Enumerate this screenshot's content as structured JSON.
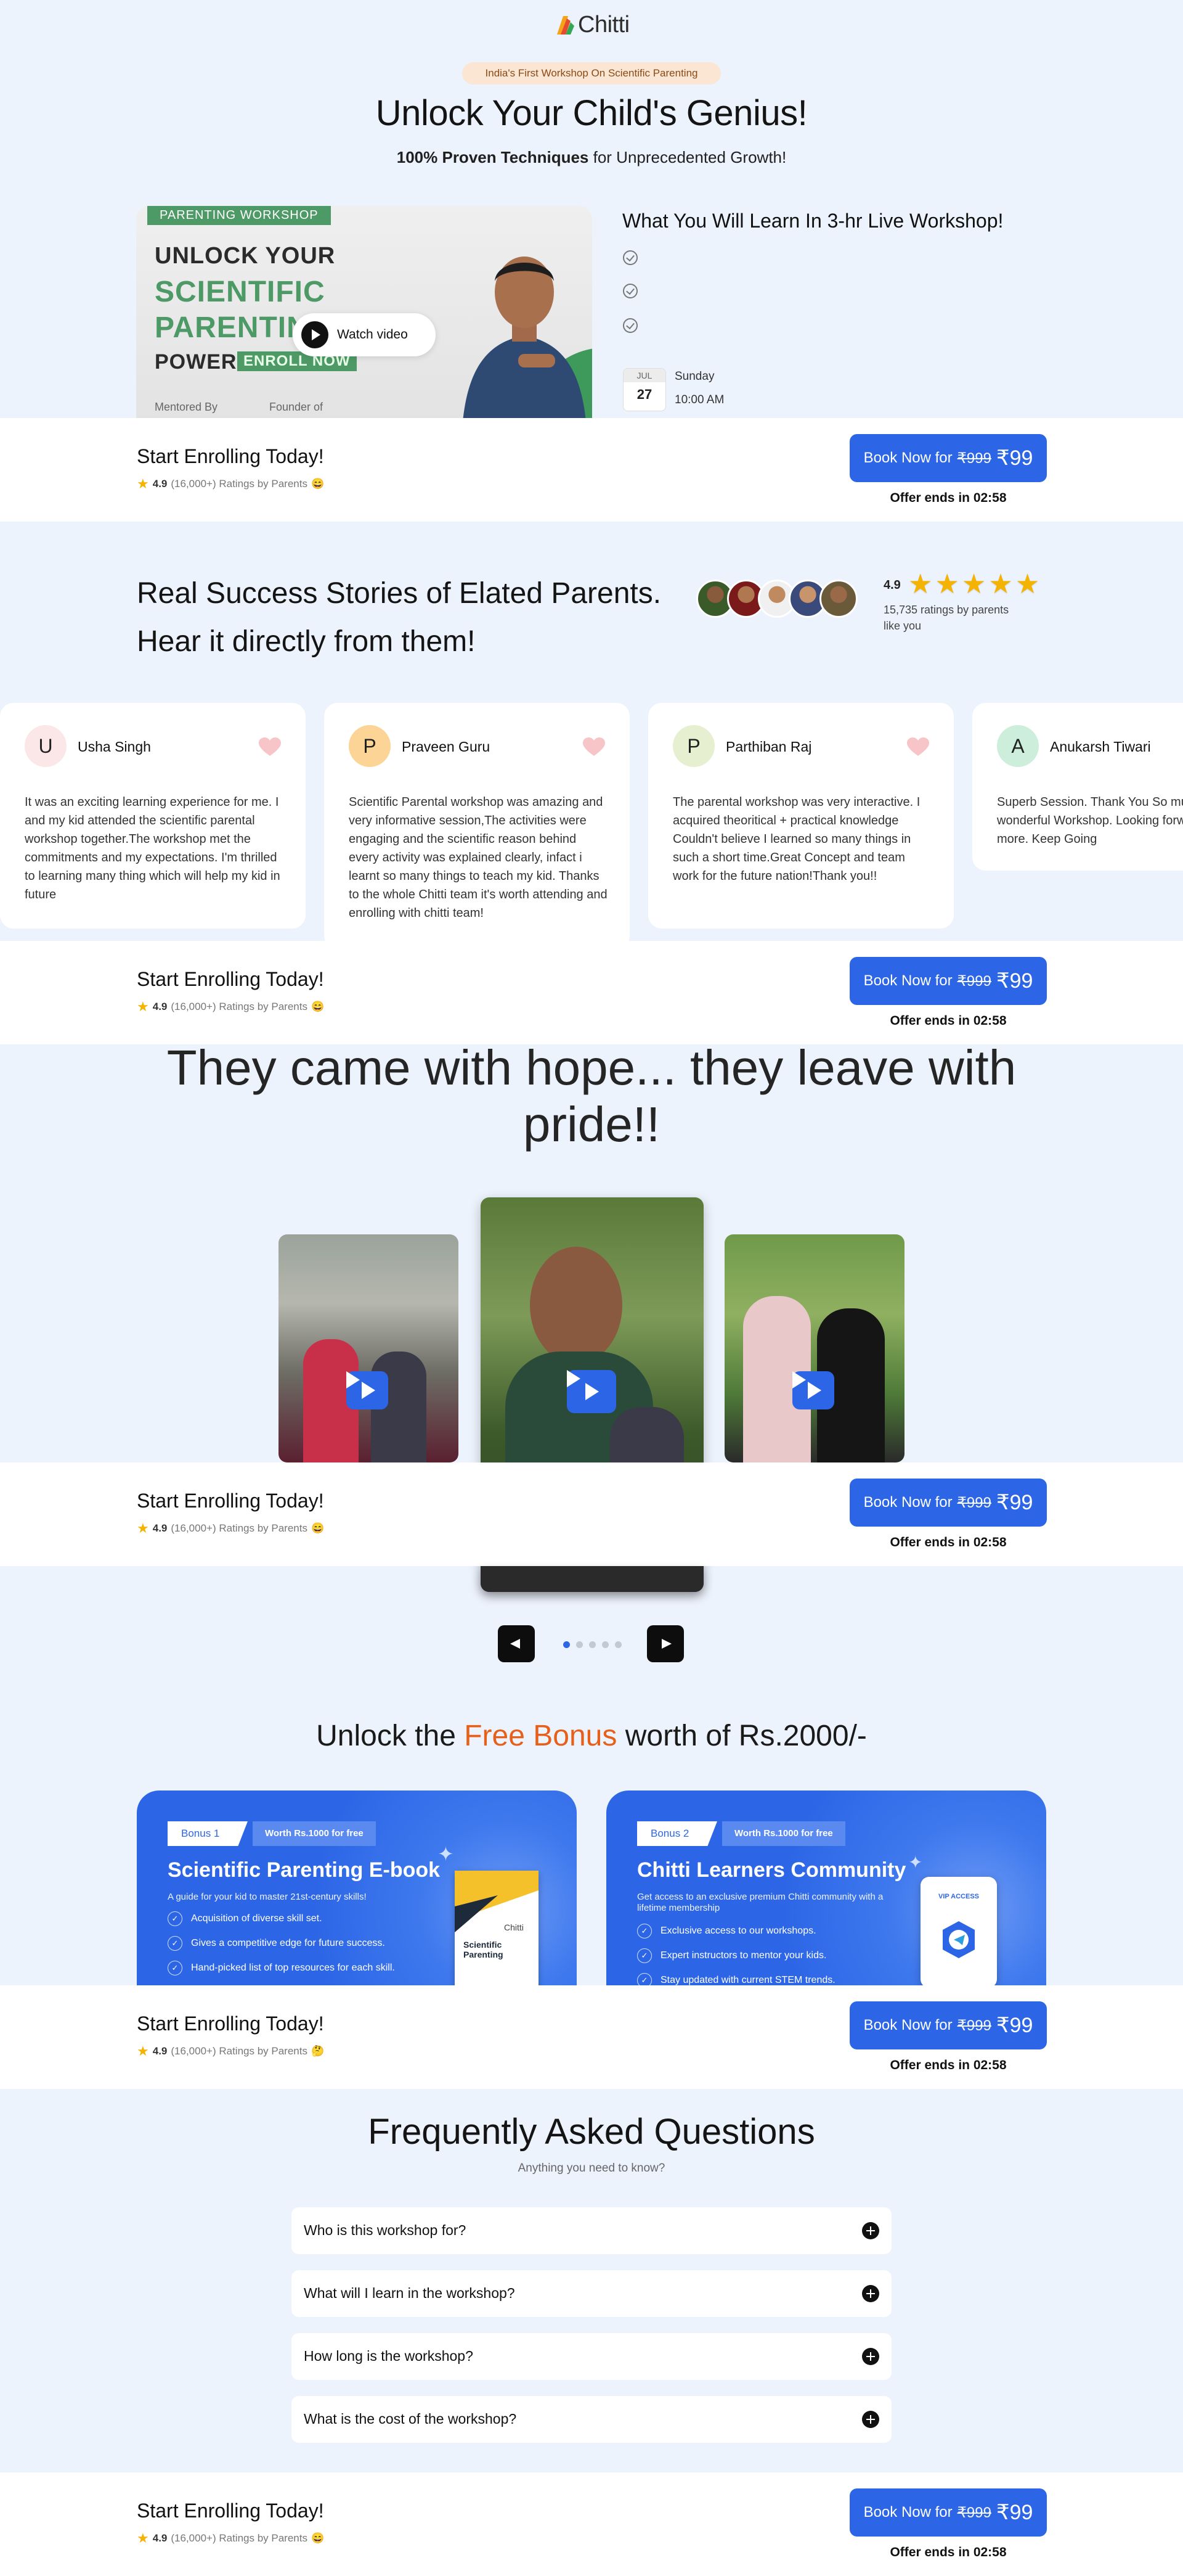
{
  "brand": {
    "name": "Chitti"
  },
  "hero": {
    "pill": "India's First Workshop On Scientific Parenting",
    "title": "Unlock Your Child's Genius!",
    "subtitle_bold": "100% Proven Techniques",
    "subtitle_rest": " for Unprecedented Growth!",
    "video": {
      "badge": "PARENTING WORKSHOP",
      "line1": "UNLOCK YOUR",
      "line2": "SCIENTIFIC",
      "line3": "PARENTIN",
      "line4": "POWER",
      "enroll": "ENROLL NOW",
      "mentor": "Mentored By",
      "founder": "Founder of",
      "watch_label": "Watch video"
    },
    "learn_title": "What You Will Learn In 3-hr Live Workshop!",
    "date": {
      "month": "JUL",
      "day": "27",
      "weekday": "Sunday",
      "time": "10:00 AM"
    }
  },
  "cta": {
    "title": "Start Enrolling Today!",
    "rating": "4.9",
    "rating_text": "(16,000+) Ratings by Parents",
    "emoji_happy": "😄",
    "emoji_alt": "🤔",
    "btn_prefix": "Book Now for",
    "old_price": "₹999",
    "new_price": "₹99",
    "offer": "Offer ends in 02:58"
  },
  "stories": {
    "title_line1": "Real Success Stories of Elated Parents.",
    "title_line2": "Hear it directly from them!",
    "rating": "4.9",
    "rating_sub": "15,735 ratings by parents like you",
    "reviews": [
      {
        "initial": "U",
        "name": "Usha Singh",
        "color": "#fbe7e7",
        "text": "It was an exciting learning experience for me. I and my kid attended the scientific parental workshop together.The workshop met the commitments and my expectations. I'm thrilled to learning many thing which will help my kid in future"
      },
      {
        "initial": "P",
        "name": "Praveen Guru",
        "color": "#fcd596",
        "text": "Scientific Parental workshop was amazing and very informative session,The activities were engaging and the scientific reason behind every activity was explained clearly, infact i learnt so many things to teach my kid. Thanks to the whole Chitti team it's worth attending and enrolling with chitti team!"
      },
      {
        "initial": "P",
        "name": "Parthiban Raj",
        "color": "#e6efcf",
        "text": "The parental workshop was very interactive. I acquired theoritical + practical knowledge Couldn't believe I learned so many things in such a short time.Great Concept and team work for the future nation!Thank you!!"
      },
      {
        "initial": "A",
        "name": "Anukarsh Tiwari",
        "color": "#cdeedb",
        "text": "Superb Session. Thank You So much for this wonderful Workshop. Looking forward for more. Keep Going"
      }
    ]
  },
  "hope": {
    "title": "They came with hope... they leave with pride!!"
  },
  "bonus": {
    "title_pre": "Unlock the ",
    "title_free": "Free Bonus",
    "title_post": " worth of Rs.2000/-",
    "cards": [
      {
        "tag": "Bonus 1",
        "worth": "Worth Rs.1000 for free",
        "head": "Scientific Parenting E-book",
        "desc": "A guide for your kid to master 21st-century skills!",
        "items": [
          "Acquisition of diverse skill set.",
          "Gives a competitive edge for future success.",
          "Hand-picked list of top resources for each skill."
        ],
        "book_title": "Scientific Parenting"
      },
      {
        "tag": "Bonus 2",
        "worth": "Worth Rs.1000 for free",
        "head": "Chitti Learners Community",
        "desc": "Get access to an exclusive premium Chitti community with a lifetime membership",
        "items": [
          "Exclusive access to our workshops.",
          "Expert instructors to mentor your kids.",
          "Stay updated with current STEM trends."
        ],
        "vip": "VIP ACCESS"
      }
    ]
  },
  "faq": {
    "title": "Frequently Asked Questions",
    "subtitle": "Anything you need to know?",
    "items": [
      "Who is this workshop for?",
      "What will I learn in the workshop?",
      "How long is the workshop?",
      "What is the cost of the workshop?"
    ]
  },
  "colors": {
    "accent": "#2c66e6",
    "orange": "#e6601c",
    "page_bg": "#edf3fd"
  }
}
